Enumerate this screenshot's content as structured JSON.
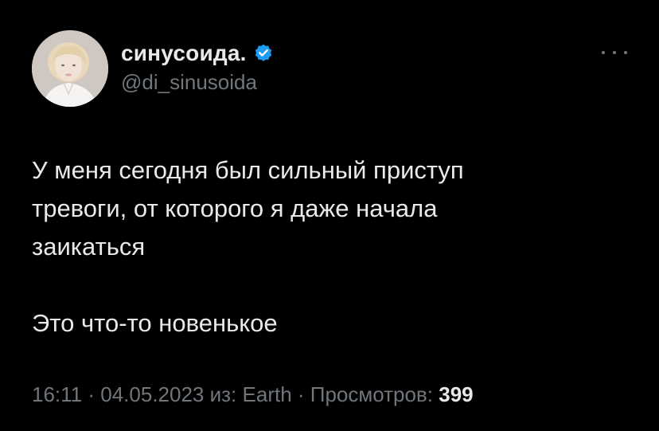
{
  "author": {
    "display_name": "синусоида.",
    "handle": "@di_sinusoida",
    "verified_color": "#1d9bf0"
  },
  "menu": {
    "icon": "more-horizontal-icon"
  },
  "tweet": {
    "lines": [
      "У меня сегодня был сильный приступ",
      "тревоги, от которого я даже начала",
      "заикаться"
    ],
    "second_paragraph": "Это что-то новенькое"
  },
  "meta": {
    "time": "16:11",
    "sep1": " · ",
    "date": "04.05.2023",
    "source_prefix": " из: ",
    "source": "Earth",
    "sep2": " · ",
    "views_label": "Просмотров: ",
    "views_count": "399"
  }
}
